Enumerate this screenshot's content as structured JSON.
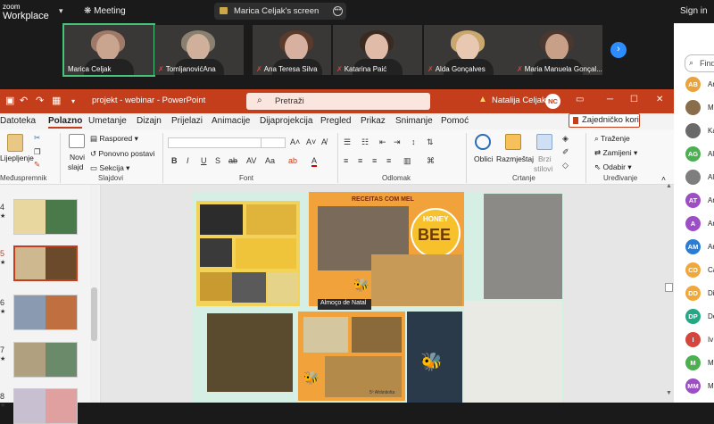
{
  "zoom": {
    "logo_line1": "zoom",
    "logo_line2": "Workplace",
    "meeting": "Meeting",
    "share_label": "Marica Celjak's screen",
    "sign_in": "Sign in",
    "next_icon": "chevron-right-icon"
  },
  "participants": [
    {
      "name": "Marica Celjak",
      "muted": false
    },
    {
      "name": "TomljanovićAna",
      "muted": true
    },
    {
      "name": "Ana Teresa Silva",
      "muted": true
    },
    {
      "name": "Katarina Paić",
      "muted": true
    },
    {
      "name": "Alda Gonçalves",
      "muted": true
    },
    {
      "name": "Maria Manuela Gonçal...",
      "muted": true
    }
  ],
  "ppt": {
    "doc_title": "projekt - webinar - PowerPoint",
    "search": "Pretraži",
    "user": "Natalija Celjak",
    "initials": "NC",
    "tabs": [
      "Datoteka",
      "Polazno",
      "Umetanje",
      "Dizajn",
      "Prijelazi",
      "Animacije",
      "Dijaprojekcija",
      "Pregled",
      "Prikaz",
      "Snimanje",
      "Pomoć"
    ],
    "active_tab": "Polazno",
    "share": "Zajedničko korištenje",
    "ribbon": {
      "paste": "Lijepljenje",
      "new_slide_1": "Novi",
      "new_slide_2": "slajd",
      "layout": "Raspored",
      "reset": "Ponovno postavi",
      "section": "Sekcija",
      "shapes": "Oblici",
      "arrange": "Razmještaj",
      "quick_1": "Brzi",
      "quick_2": "stilovi",
      "find": "Traženje",
      "replace": "Zamijeni",
      "select": "Odabir",
      "g_clipboard": "Međuspremnik",
      "g_slides": "Slajdovi",
      "g_font": "Font",
      "g_paragraph": "Odlomak",
      "g_drawing": "Crtanje",
      "g_editing": "Uređivanje"
    },
    "slide_numbers": [
      "4",
      "5",
      "6",
      "7",
      "8"
    ],
    "selected_slide": "5",
    "slide": {
      "receitas": "RECEITAS COM MEL",
      "honey": "HONEY",
      "bee": "BEE",
      "almoco": "Almoço de Natal",
      "caption": "5º Afrântiolta"
    }
  },
  "panel": {
    "search": "Find",
    "people": [
      {
        "initials": "AB",
        "label": "Ar",
        "color": "#e8a33c"
      },
      {
        "initials": "",
        "label": "M",
        "color": "#8a6e4c"
      },
      {
        "initials": "",
        "label": "Ka",
        "color": "#6a6a6a"
      },
      {
        "initials": "AG",
        "label": "Al",
        "color": "#4caf50"
      },
      {
        "initials": "",
        "label": "Al",
        "color": "#7e7e7e"
      },
      {
        "initials": "AT",
        "label": "Ar",
        "color": "#9c4fc4"
      },
      {
        "initials": "A",
        "label": "Ar",
        "color": "#9c4fc4"
      },
      {
        "initials": "AM",
        "label": "Ar",
        "color": "#2b7cd3"
      },
      {
        "initials": "CD",
        "label": "Ca",
        "color": "#f0a83a"
      },
      {
        "initials": "DD",
        "label": "Di",
        "color": "#f0a83a"
      },
      {
        "initials": "DP",
        "label": "Do",
        "color": "#22a884"
      },
      {
        "initials": "I",
        "label": "Iv",
        "color": "#d6453d"
      },
      {
        "initials": "M",
        "label": "M",
        "color": "#4caf50"
      },
      {
        "initials": "MM",
        "label": "M",
        "color": "#9c4fc4"
      }
    ]
  }
}
